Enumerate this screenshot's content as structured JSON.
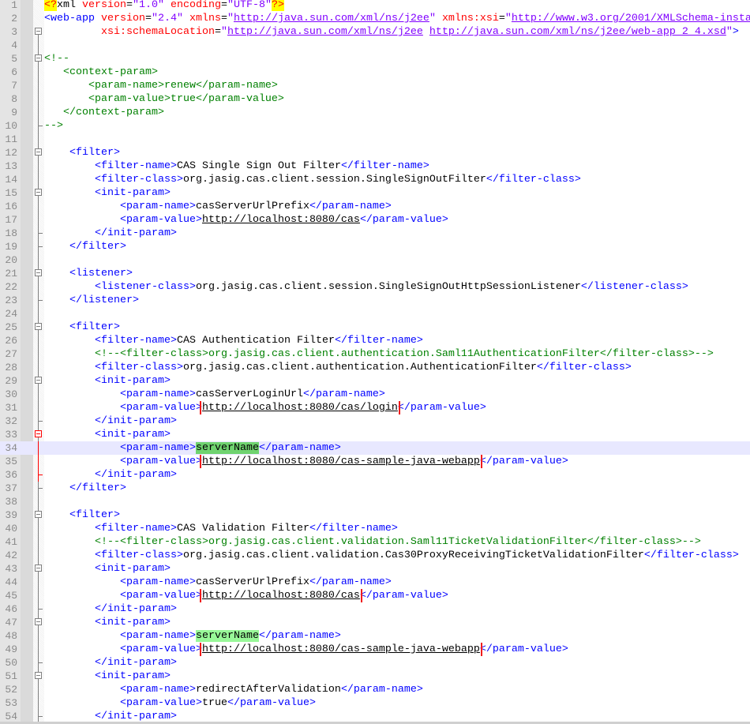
{
  "editor": {
    "current_line": 34,
    "lines": [
      [
        [
          "pi",
          "<?"
        ],
        [
          "t",
          "xml "
        ],
        [
          "a",
          "version"
        ],
        [
          "e",
          "="
        ],
        [
          "v",
          "\"1.0\""
        ],
        [
          "t",
          " "
        ],
        [
          "a",
          "encoding"
        ],
        [
          "e",
          "="
        ],
        [
          "v",
          "\"UTF-8\""
        ],
        [
          "pi",
          "?>"
        ]
      ],
      [
        [
          "g",
          "<web-app "
        ],
        [
          "a",
          "version"
        ],
        [
          "e",
          "="
        ],
        [
          "v",
          "\"2.4\""
        ],
        [
          "t",
          " "
        ],
        [
          "a",
          "xmlns"
        ],
        [
          "e",
          "="
        ],
        [
          "v",
          "\""
        ],
        [
          "vu",
          "http://java.sun.com/xml/ns/j2ee"
        ],
        [
          "v",
          "\""
        ],
        [
          "t",
          " "
        ],
        [
          "a",
          "xmlns:xsi"
        ],
        [
          "e",
          "="
        ],
        [
          "v",
          "\""
        ],
        [
          "vu",
          "http://www.w3.org/2001/XMLSchema-insta"
        ]
      ],
      [
        [
          "t",
          "         "
        ],
        [
          "a",
          "xsi:schemaLocation"
        ],
        [
          "e",
          "="
        ],
        [
          "v",
          "\""
        ],
        [
          "vu",
          "http://java.sun.com/xml/ns/j2ee"
        ],
        [
          "v",
          " "
        ],
        [
          "vu",
          "http://java.sun.com/xml/ns/j2ee/web-app_2_4.xsd"
        ],
        [
          "v",
          "\""
        ],
        [
          "g",
          ">"
        ]
      ],
      [],
      [
        [
          "c",
          "<!--"
        ]
      ],
      [
        [
          "c",
          "   <context-param>"
        ]
      ],
      [
        [
          "c",
          "       <param-name>renew</param-name>"
        ]
      ],
      [
        [
          "c",
          "       <param-value>true</param-value>"
        ]
      ],
      [
        [
          "c",
          "   </context-param>"
        ]
      ],
      [
        [
          "c",
          "-->"
        ]
      ],
      [],
      [
        [
          "t",
          "    "
        ],
        [
          "g",
          "<filter>"
        ]
      ],
      [
        [
          "t",
          "        "
        ],
        [
          "g",
          "<filter-name>"
        ],
        [
          "t",
          "CAS Single Sign Out Filter"
        ],
        [
          "g",
          "</filter-name>"
        ]
      ],
      [
        [
          "t",
          "        "
        ],
        [
          "g",
          "<filter-class>"
        ],
        [
          "t",
          "org.jasig.cas.client.session.SingleSignOutFilter"
        ],
        [
          "g",
          "</filter-class>"
        ]
      ],
      [
        [
          "t",
          "        "
        ],
        [
          "g",
          "<init-param>"
        ]
      ],
      [
        [
          "t",
          "            "
        ],
        [
          "g",
          "<param-name>"
        ],
        [
          "t",
          "casServerUrlPrefix"
        ],
        [
          "g",
          "</param-name>"
        ]
      ],
      [
        [
          "t",
          "            "
        ],
        [
          "g",
          "<param-value>"
        ],
        [
          "u",
          "http://localhost:8080/cas"
        ],
        [
          "g",
          "</param-value>"
        ]
      ],
      [
        [
          "t",
          "        "
        ],
        [
          "g",
          "</init-param>"
        ]
      ],
      [
        [
          "t",
          "    "
        ],
        [
          "g",
          "</filter>"
        ]
      ],
      [],
      [
        [
          "t",
          "    "
        ],
        [
          "g",
          "<listener>"
        ]
      ],
      [
        [
          "t",
          "        "
        ],
        [
          "g",
          "<listener-class>"
        ],
        [
          "t",
          "org.jasig.cas.client.session.SingleSignOutHttpSessionListener"
        ],
        [
          "g",
          "</listener-class>"
        ]
      ],
      [
        [
          "t",
          "    "
        ],
        [
          "g",
          "</listener>"
        ]
      ],
      [],
      [
        [
          "t",
          "    "
        ],
        [
          "g",
          "<filter>"
        ]
      ],
      [
        [
          "t",
          "        "
        ],
        [
          "g",
          "<filter-name>"
        ],
        [
          "t",
          "CAS Authentication Filter"
        ],
        [
          "g",
          "</filter-name>"
        ]
      ],
      [
        [
          "t",
          "        "
        ],
        [
          "c",
          "<!--<filter-class>org.jasig.cas.client.authentication.Saml11AuthenticationFilter</filter-class>-->"
        ]
      ],
      [
        [
          "t",
          "        "
        ],
        [
          "g",
          "<filter-class>"
        ],
        [
          "t",
          "org.jasig.cas.client.authentication.AuthenticationFilter"
        ],
        [
          "g",
          "</filter-class>"
        ]
      ],
      [
        [
          "t",
          "        "
        ],
        [
          "g",
          "<init-param>"
        ]
      ],
      [
        [
          "t",
          "            "
        ],
        [
          "g",
          "<param-name>"
        ],
        [
          "t",
          "casServerLoginUrl"
        ],
        [
          "g",
          "</param-name>"
        ]
      ],
      [
        [
          "t",
          "            "
        ],
        [
          "g",
          "<param-value>"
        ],
        [
          "u box",
          "http://localhost:8080/cas/login"
        ],
        [
          "g",
          "</param-value>"
        ]
      ],
      [
        [
          "t",
          "        "
        ],
        [
          "g",
          "</init-param>"
        ]
      ],
      [
        [
          "t",
          "        "
        ],
        [
          "g",
          "<init-param>"
        ]
      ],
      [
        [
          "t",
          "            "
        ],
        [
          "g",
          "<param-name>"
        ],
        [
          "hl",
          "serverName"
        ],
        [
          "g",
          "</param-name>"
        ]
      ],
      [
        [
          "t",
          "            "
        ],
        [
          "g",
          "<param-value>"
        ],
        [
          "u box",
          "http://localhost:8080/cas-sample-java-webapp"
        ],
        [
          "g",
          "</param-value>"
        ]
      ],
      [
        [
          "t",
          "        "
        ],
        [
          "g",
          "</init-param>"
        ]
      ],
      [
        [
          "t",
          "    "
        ],
        [
          "g",
          "</filter>"
        ]
      ],
      [],
      [
        [
          "t",
          "    "
        ],
        [
          "g",
          "<filter>"
        ]
      ],
      [
        [
          "t",
          "        "
        ],
        [
          "g",
          "<filter-name>"
        ],
        [
          "t",
          "CAS Validation Filter"
        ],
        [
          "g",
          "</filter-name>"
        ]
      ],
      [
        [
          "t",
          "        "
        ],
        [
          "c",
          "<!--<filter-class>org.jasig.cas.client.validation.Saml11TicketValidationFilter</filter-class>-->"
        ]
      ],
      [
        [
          "t",
          "        "
        ],
        [
          "g",
          "<filter-class>"
        ],
        [
          "t",
          "org.jasig.cas.client.validation.Cas30ProxyReceivingTicketValidationFilter"
        ],
        [
          "g",
          "</filter-class>"
        ]
      ],
      [
        [
          "t",
          "        "
        ],
        [
          "g",
          "<init-param>"
        ]
      ],
      [
        [
          "t",
          "            "
        ],
        [
          "g",
          "<param-name>"
        ],
        [
          "t",
          "casServerUrlPrefix"
        ],
        [
          "g",
          "</param-name>"
        ]
      ],
      [
        [
          "t",
          "            "
        ],
        [
          "g",
          "<param-value>"
        ],
        [
          "u box",
          "http://localhost:8080/cas"
        ],
        [
          "g",
          "</param-value>"
        ]
      ],
      [
        [
          "t",
          "        "
        ],
        [
          "g",
          "</init-param>"
        ]
      ],
      [
        [
          "t",
          "        "
        ],
        [
          "g",
          "<init-param>"
        ]
      ],
      [
        [
          "t",
          "            "
        ],
        [
          "g",
          "<param-name>"
        ],
        [
          "hl2",
          "serverName"
        ],
        [
          "g",
          "</param-name>"
        ]
      ],
      [
        [
          "t",
          "            "
        ],
        [
          "g",
          "<param-value>"
        ],
        [
          "u box",
          "http://localhost:8080/cas-sample-java-webapp"
        ],
        [
          "g",
          "</param-value>"
        ]
      ],
      [
        [
          "t",
          "        "
        ],
        [
          "g",
          "</init-param>"
        ]
      ],
      [
        [
          "t",
          "        "
        ],
        [
          "g",
          "<init-param>"
        ]
      ],
      [
        [
          "t",
          "            "
        ],
        [
          "g",
          "<param-name>"
        ],
        [
          "t",
          "redirectAfterValidation"
        ],
        [
          "g",
          "</param-name>"
        ]
      ],
      [
        [
          "t",
          "            "
        ],
        [
          "g",
          "<param-value>"
        ],
        [
          "t",
          "true"
        ],
        [
          "g",
          "</param-value>"
        ]
      ],
      [
        [
          "t",
          "        "
        ],
        [
          "g",
          "</init-param>"
        ]
      ]
    ]
  }
}
